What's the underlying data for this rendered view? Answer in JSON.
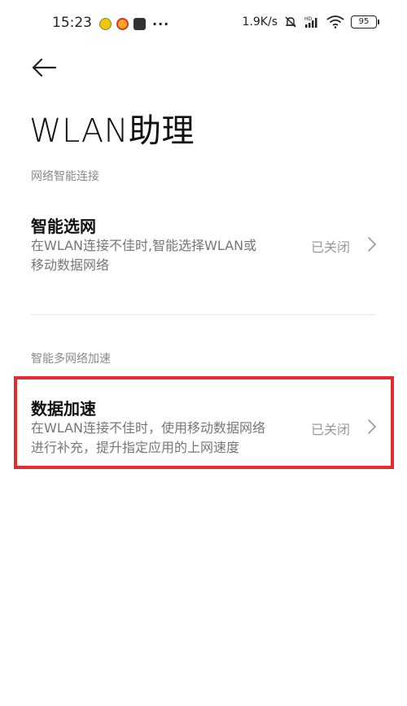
{
  "status_bar": {
    "time": "15:23",
    "more": "···",
    "net_speed": "1.9K/s",
    "battery": "95"
  },
  "header": {
    "title": "WLAN助理"
  },
  "sections": [
    {
      "header": "网络智能连接",
      "items": [
        {
          "title": "智能选网",
          "description_line1": "在WLAN连接不佳时,智能选择WLAN或",
          "description_line2": "移动数据网络",
          "status": "已关闭"
        }
      ]
    },
    {
      "header": "智能多网络加速",
      "items": [
        {
          "title": "数据加速",
          "description_line1": "在WLAN连接不佳时，使用移动数据网络",
          "description_line2": "进行补充，提升指定应用的上网速度",
          "status": "已关闭"
        }
      ]
    }
  ],
  "colors": {
    "highlight": "#e52b2b",
    "secondary_text": "#777777",
    "status_text": "#9a9a9a"
  }
}
